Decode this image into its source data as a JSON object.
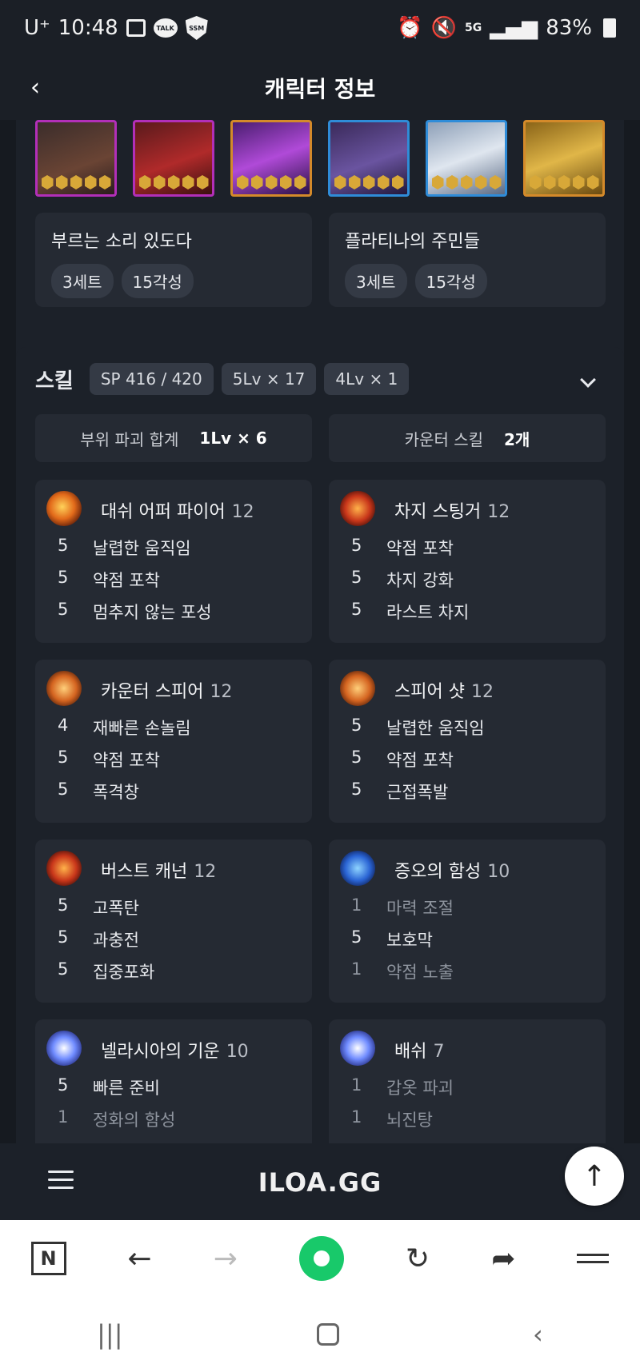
{
  "status": {
    "carrier": "U⁺",
    "time": "10:48",
    "network": "5G",
    "battery": "83%"
  },
  "header": {
    "back_icon": "chevron-left-icon",
    "title": "캐릭터 정보"
  },
  "gems": [
    {
      "color": "#b22fb8"
    },
    {
      "color": "#b22fb8"
    },
    {
      "color": "#d48a2a"
    },
    {
      "color": "#2f8cd8"
    },
    {
      "color": "#2f8cd8"
    },
    {
      "color": "#d48a2a"
    }
  ],
  "sets": [
    {
      "name": "부르는 소리 있도다",
      "chips": [
        "3세트",
        "15각성"
      ]
    },
    {
      "name": "플라티나의 주민들",
      "chips": [
        "3세트",
        "15각성"
      ]
    }
  ],
  "skill": {
    "label": "스킬",
    "pills": [
      "SP 416 / 420",
      "5Lv × 17",
      "4Lv × 1"
    ],
    "summary": [
      {
        "label": "부위 파괴 합계",
        "value": "1Lv × 6"
      },
      {
        "label": "카운터 스킬",
        "value": "2개"
      }
    ],
    "skills": [
      {
        "name": "대쉬 어퍼 파이어",
        "level": "12",
        "icon": "fire-dash-icon",
        "tripods": [
          {
            "n": "5",
            "t": "날렵한 움직임",
            "dim": false
          },
          {
            "n": "5",
            "t": "약점 포착",
            "dim": false
          },
          {
            "n": "5",
            "t": "멈추지 않는 포성",
            "dim": false
          }
        ]
      },
      {
        "name": "차지 스팅거",
        "level": "12",
        "icon": "charge-stinger-icon",
        "tripods": [
          {
            "n": "5",
            "t": "약점 포착",
            "dim": false
          },
          {
            "n": "5",
            "t": "차지 강화",
            "dim": false
          },
          {
            "n": "5",
            "t": "라스트 차지",
            "dim": false
          }
        ]
      },
      {
        "name": "카운터 스피어",
        "level": "12",
        "icon": "counter-spear-icon",
        "tripods": [
          {
            "n": "4",
            "t": "재빠른 손놀림",
            "dim": false
          },
          {
            "n": "5",
            "t": "약점 포착",
            "dim": false
          },
          {
            "n": "5",
            "t": "폭격창",
            "dim": false
          }
        ]
      },
      {
        "name": "스피어 샷",
        "level": "12",
        "icon": "spear-shot-icon",
        "tripods": [
          {
            "n": "5",
            "t": "날렵한 움직임",
            "dim": false
          },
          {
            "n": "5",
            "t": "약점 포착",
            "dim": false
          },
          {
            "n": "5",
            "t": "근접폭발",
            "dim": false
          }
        ]
      },
      {
        "name": "버스트 캐넌",
        "level": "12",
        "icon": "burst-cannon-icon",
        "tripods": [
          {
            "n": "5",
            "t": "고폭탄",
            "dim": false
          },
          {
            "n": "5",
            "t": "과충전",
            "dim": false
          },
          {
            "n": "5",
            "t": "집중포화",
            "dim": false
          }
        ]
      },
      {
        "name": "증오의 함성",
        "level": "10",
        "icon": "roar-of-hatred-icon",
        "tripods": [
          {
            "n": "1",
            "t": "마력 조절",
            "dim": true
          },
          {
            "n": "5",
            "t": "보호막",
            "dim": false
          },
          {
            "n": "1",
            "t": "약점 노출",
            "dim": true
          }
        ]
      },
      {
        "name": "넬라시아의 기운",
        "level": "10",
        "icon": "nellasia-energy-icon",
        "tripods": [
          {
            "n": "5",
            "t": "빠른 준비",
            "dim": false
          },
          {
            "n": "1",
            "t": "정화의 함성",
            "dim": true
          }
        ]
      },
      {
        "name": "배쉬",
        "level": "7",
        "icon": "bash-icon",
        "tripods": [
          {
            "n": "1",
            "t": "갑옷 파괴",
            "dim": true
          },
          {
            "n": "1",
            "t": "뇌진탕",
            "dim": true
          }
        ]
      }
    ]
  },
  "footer": {
    "logo": "ILOA.GG",
    "menu_icon": "hamburger-icon",
    "top_icon": "arrow-up-icon"
  },
  "browser": {
    "n_label": "N"
  }
}
